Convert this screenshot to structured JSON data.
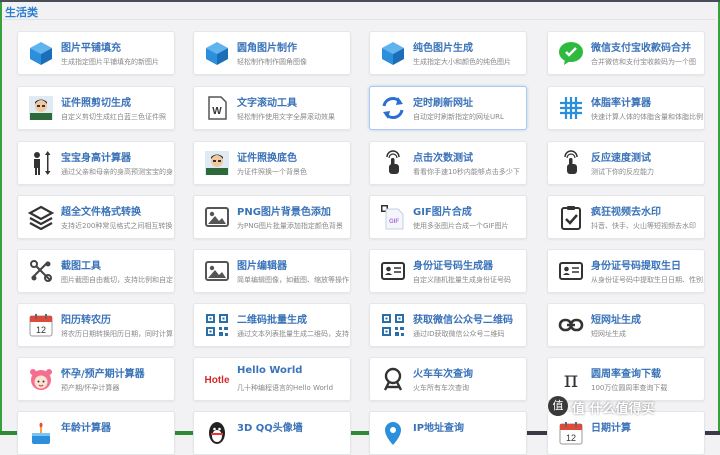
{
  "section": {
    "title": "生活类"
  },
  "cards": [
    {
      "title": "图片平铺填充",
      "desc": "生成指定图片平铺填充的新图片",
      "icon": "cube-icon"
    },
    {
      "title": "圆角图片制作",
      "desc": "轻松制作制作圆角图像",
      "icon": "cube-icon"
    },
    {
      "title": "纯色图片生成",
      "desc": "生成指定大小和颜色的纯色图片",
      "icon": "cube-icon"
    },
    {
      "title": "微信支付宝收款码合并",
      "desc": "合并微信和支付宝收款码为一个图",
      "icon": "wechat-icon"
    },
    {
      "title": "证件照剪切生成",
      "desc": "自定义剪切生成红白蓝三色证件照",
      "icon": "avatar-icon"
    },
    {
      "title": "文字滚动工具",
      "desc": "轻松制作使用文字全屏滚动效果",
      "icon": "document-icon"
    },
    {
      "title": "定时刷新网址",
      "desc": "自动定时刷新指定的网址URL",
      "icon": "refresh-icon"
    },
    {
      "title": "体脂率计算器",
      "desc": "快速计算人体的体脂含量和体脂比例",
      "icon": "grid-icon"
    },
    {
      "title": "宝宝身高计算器",
      "desc": "通过父亲和母亲的身高预测宝宝的身高",
      "icon": "height-icon"
    },
    {
      "title": "证件照换底色",
      "desc": "为证件照换一个背景色",
      "icon": "avatar-icon"
    },
    {
      "title": "点击次数测试",
      "desc": "看看你手速10秒内能够点击多少下",
      "icon": "tap-icon"
    },
    {
      "title": "反应速度测试",
      "desc": "测试下你的反应能力",
      "icon": "tap-icon"
    },
    {
      "title": "超全文件格式转换",
      "desc": "支持近200种常见格式之间相互转换",
      "icon": "layers-icon"
    },
    {
      "title": "PNG图片背景色添加",
      "desc": "为PNG图片批量添加指定颜色背景",
      "icon": "image-icon"
    },
    {
      "title": "GIF图片合成",
      "desc": "使用多张图片合成一个GIF图片",
      "icon": "gif-icon"
    },
    {
      "title": "疯狂视频去水印",
      "desc": "抖音、快手、火山等短视频去水印",
      "icon": "clipboard-check-icon"
    },
    {
      "title": "截图工具",
      "desc": "图片截图自由裁切，支持比例和自定义",
      "icon": "crop-icon"
    },
    {
      "title": "图片编辑器",
      "desc": "简单编辑图像，如截图、缩放等操作",
      "icon": "image-icon"
    },
    {
      "title": "身份证号码生成器",
      "desc": "自定义随机批量生成身份证号码",
      "icon": "id-card-icon"
    },
    {
      "title": "身份证号码提取生日",
      "desc": "从身份证号码中提取生日日期、性别",
      "icon": "id-card-icon"
    },
    {
      "title": "阳历转农历",
      "desc": "将农历日期转换阳历日期，同时计算",
      "icon": "calendar-icon"
    },
    {
      "title": "二维码批量生成",
      "desc": "通过文本列表批量生成二维码，支持",
      "icon": "qrcode-icon"
    },
    {
      "title": "获取微信公众号二维码",
      "desc": "通过ID获取微信公众号二维码",
      "icon": "qrcode-icon"
    },
    {
      "title": "短网址生成",
      "desc": "短网址生成",
      "icon": "link-icon"
    },
    {
      "title": "怀孕/预产期计算器",
      "desc": "预产期/怀孕计算器",
      "icon": "girl-icon"
    },
    {
      "title": "Hello World",
      "desc": "几十种编程语言的Hello World",
      "icon": "hottie-icon"
    },
    {
      "title": "火车车次查询",
      "desc": "火车所有车次查询",
      "icon": "train-icon"
    },
    {
      "title": "圆周率查询下载",
      "desc": "100万位圆周率查询下载",
      "icon": "pi-icon"
    },
    {
      "title": "年龄计算器",
      "desc": "",
      "icon": "cake-icon"
    },
    {
      "title": "3D QQ头像墙",
      "desc": "",
      "icon": "qq-icon"
    },
    {
      "title": "IP地址查询",
      "desc": "",
      "icon": "location-icon"
    },
    {
      "title": "日期计算",
      "desc": "",
      "icon": "calendar-icon"
    }
  ],
  "watermark": {
    "text": "值 什么值得买",
    "badge": "值"
  },
  "colors": {
    "accent": "#3a73b8",
    "frame": "#37a13c",
    "icon_blue": "#2b8fdc",
    "icon_dark": "#333333"
  }
}
